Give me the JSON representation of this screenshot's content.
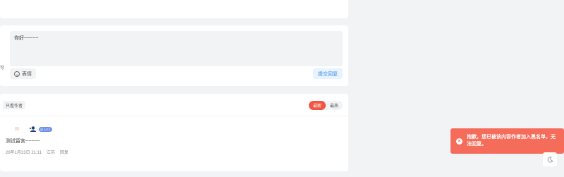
{
  "comment_form": {
    "text_value": "你好~~~~~",
    "edge_char": "可",
    "emoji_label": "表情",
    "submit_label": "提交回复"
  },
  "comments": {
    "author_only_label": "只看作者",
    "sort": {
      "newest": "最新",
      "hottest": "最热",
      "active": "newest"
    },
    "items": [
      {
        "badge_icon_text": "◎",
        "badge_label": "Lv.1",
        "text": "测试留言~~~~~",
        "date": "26年1月23日 21:11",
        "location": "江苏",
        "reply_label": "回复"
      }
    ]
  },
  "toast": {
    "icon": "close-icon",
    "message": "抱歉，您已被该内容作者加入黑名单，无法回复。",
    "color": "#f56c5b"
  },
  "theme_toggle": {
    "icon": "moon-icon"
  }
}
